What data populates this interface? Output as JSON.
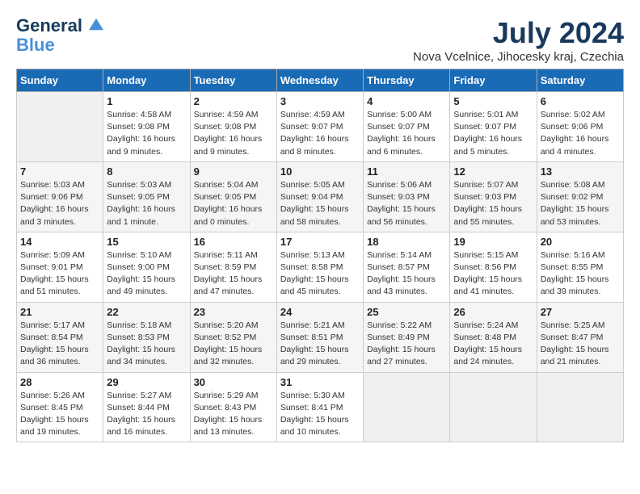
{
  "header": {
    "logo_line1": "General",
    "logo_line2": "Blue",
    "month_title": "July 2024",
    "location": "Nova Vcelnice, Jihocesky kraj, Czechia"
  },
  "weekdays": [
    "Sunday",
    "Monday",
    "Tuesday",
    "Wednesday",
    "Thursday",
    "Friday",
    "Saturday"
  ],
  "weeks": [
    [
      {
        "day": "",
        "empty": true
      },
      {
        "day": "1",
        "sunrise": "4:58 AM",
        "sunset": "9:08 PM",
        "daylight": "16 hours and 9 minutes."
      },
      {
        "day": "2",
        "sunrise": "4:59 AM",
        "sunset": "9:08 PM",
        "daylight": "16 hours and 9 minutes."
      },
      {
        "day": "3",
        "sunrise": "4:59 AM",
        "sunset": "9:07 PM",
        "daylight": "16 hours and 8 minutes."
      },
      {
        "day": "4",
        "sunrise": "5:00 AM",
        "sunset": "9:07 PM",
        "daylight": "16 hours and 6 minutes."
      },
      {
        "day": "5",
        "sunrise": "5:01 AM",
        "sunset": "9:07 PM",
        "daylight": "16 hours and 5 minutes."
      },
      {
        "day": "6",
        "sunrise": "5:02 AM",
        "sunset": "9:06 PM",
        "daylight": "16 hours and 4 minutes."
      }
    ],
    [
      {
        "day": "7",
        "sunrise": "5:03 AM",
        "sunset": "9:06 PM",
        "daylight": "16 hours and 3 minutes."
      },
      {
        "day": "8",
        "sunrise": "5:03 AM",
        "sunset": "9:05 PM",
        "daylight": "16 hours and 1 minute."
      },
      {
        "day": "9",
        "sunrise": "5:04 AM",
        "sunset": "9:05 PM",
        "daylight": "16 hours and 0 minutes."
      },
      {
        "day": "10",
        "sunrise": "5:05 AM",
        "sunset": "9:04 PM",
        "daylight": "15 hours and 58 minutes."
      },
      {
        "day": "11",
        "sunrise": "5:06 AM",
        "sunset": "9:03 PM",
        "daylight": "15 hours and 56 minutes."
      },
      {
        "day": "12",
        "sunrise": "5:07 AM",
        "sunset": "9:03 PM",
        "daylight": "15 hours and 55 minutes."
      },
      {
        "day": "13",
        "sunrise": "5:08 AM",
        "sunset": "9:02 PM",
        "daylight": "15 hours and 53 minutes."
      }
    ],
    [
      {
        "day": "14",
        "sunrise": "5:09 AM",
        "sunset": "9:01 PM",
        "daylight": "15 hours and 51 minutes."
      },
      {
        "day": "15",
        "sunrise": "5:10 AM",
        "sunset": "9:00 PM",
        "daylight": "15 hours and 49 minutes."
      },
      {
        "day": "16",
        "sunrise": "5:11 AM",
        "sunset": "8:59 PM",
        "daylight": "15 hours and 47 minutes."
      },
      {
        "day": "17",
        "sunrise": "5:13 AM",
        "sunset": "8:58 PM",
        "daylight": "15 hours and 45 minutes."
      },
      {
        "day": "18",
        "sunrise": "5:14 AM",
        "sunset": "8:57 PM",
        "daylight": "15 hours and 43 minutes."
      },
      {
        "day": "19",
        "sunrise": "5:15 AM",
        "sunset": "8:56 PM",
        "daylight": "15 hours and 41 minutes."
      },
      {
        "day": "20",
        "sunrise": "5:16 AM",
        "sunset": "8:55 PM",
        "daylight": "15 hours and 39 minutes."
      }
    ],
    [
      {
        "day": "21",
        "sunrise": "5:17 AM",
        "sunset": "8:54 PM",
        "daylight": "15 hours and 36 minutes."
      },
      {
        "day": "22",
        "sunrise": "5:18 AM",
        "sunset": "8:53 PM",
        "daylight": "15 hours and 34 minutes."
      },
      {
        "day": "23",
        "sunrise": "5:20 AM",
        "sunset": "8:52 PM",
        "daylight": "15 hours and 32 minutes."
      },
      {
        "day": "24",
        "sunrise": "5:21 AM",
        "sunset": "8:51 PM",
        "daylight": "15 hours and 29 minutes."
      },
      {
        "day": "25",
        "sunrise": "5:22 AM",
        "sunset": "8:49 PM",
        "daylight": "15 hours and 27 minutes."
      },
      {
        "day": "26",
        "sunrise": "5:24 AM",
        "sunset": "8:48 PM",
        "daylight": "15 hours and 24 minutes."
      },
      {
        "day": "27",
        "sunrise": "5:25 AM",
        "sunset": "8:47 PM",
        "daylight": "15 hours and 21 minutes."
      }
    ],
    [
      {
        "day": "28",
        "sunrise": "5:26 AM",
        "sunset": "8:45 PM",
        "daylight": "15 hours and 19 minutes."
      },
      {
        "day": "29",
        "sunrise": "5:27 AM",
        "sunset": "8:44 PM",
        "daylight": "15 hours and 16 minutes."
      },
      {
        "day": "30",
        "sunrise": "5:29 AM",
        "sunset": "8:43 PM",
        "daylight": "15 hours and 13 minutes."
      },
      {
        "day": "31",
        "sunrise": "5:30 AM",
        "sunset": "8:41 PM",
        "daylight": "15 hours and 10 minutes."
      },
      {
        "day": "",
        "empty": true
      },
      {
        "day": "",
        "empty": true
      },
      {
        "day": "",
        "empty": true
      }
    ]
  ]
}
